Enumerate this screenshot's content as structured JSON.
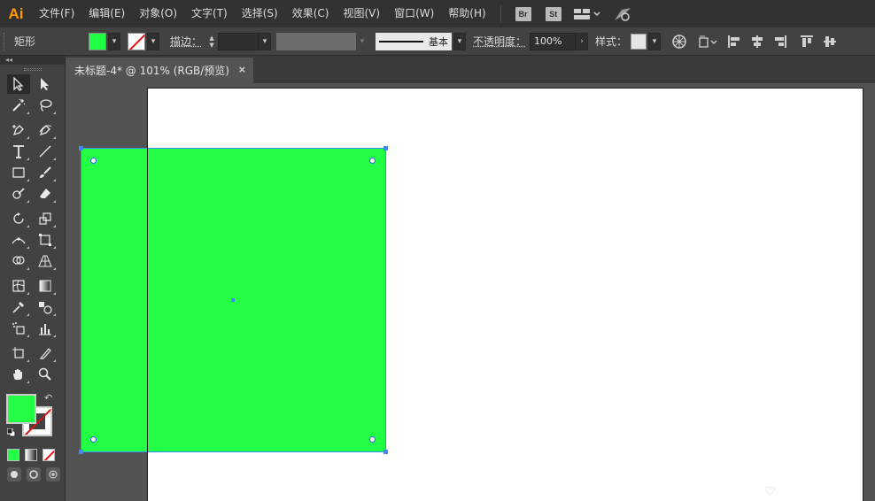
{
  "app": {
    "logo": "Ai",
    "menu": [
      "文件(F)",
      "编辑(E)",
      "对象(O)",
      "文字(T)",
      "选择(S)",
      "效果(C)",
      "视图(V)",
      "窗口(W)",
      "帮助(H)"
    ],
    "badges": [
      "Br",
      "St"
    ]
  },
  "control": {
    "tool_name": "矩形",
    "stroke_label": "描边：",
    "stroke_profile": "基本",
    "opacity_label": "不透明度：",
    "opacity_value": "100%",
    "style_label": "样式："
  },
  "document": {
    "tab_title": "未标题-4* @ 101% (RGB/预览)",
    "close_glyph": "×"
  },
  "colors": {
    "fill": "#23ff45",
    "stroke": "none",
    "selection": "#3b8cff",
    "accent_logo": "#ff9a00"
  },
  "tools_panel": {
    "collapse": "◂◂"
  }
}
